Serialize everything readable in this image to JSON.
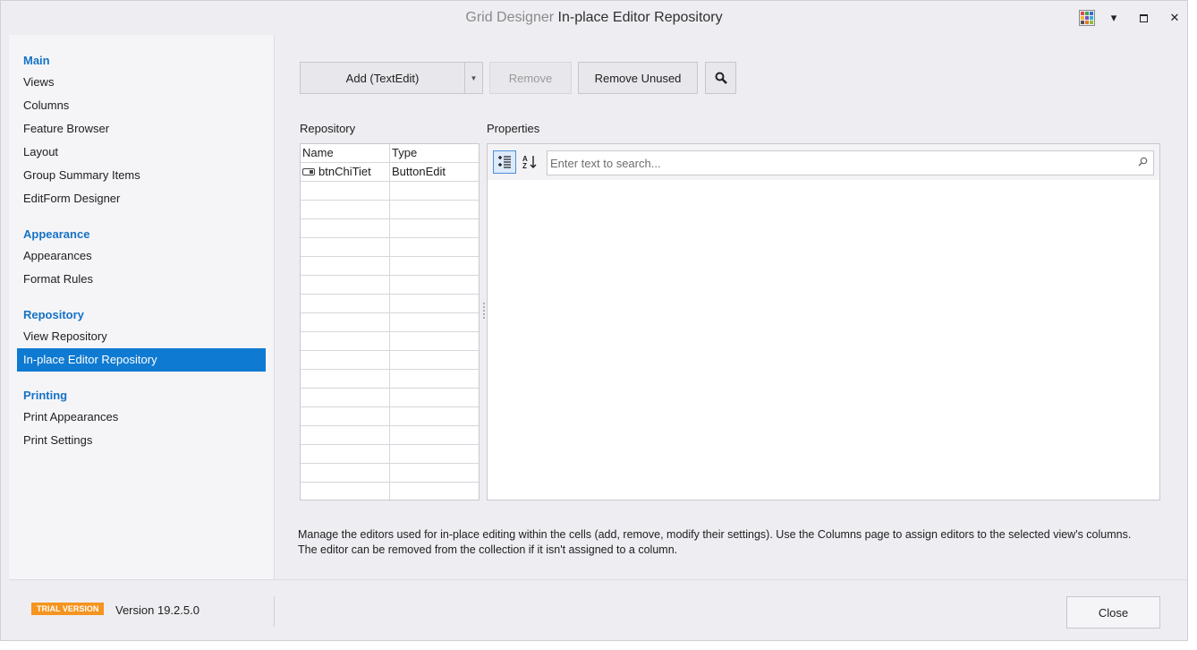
{
  "window": {
    "title_app": "Grid Designer",
    "title_page": "In-place Editor Repository",
    "skin_icon": "color-grid-icon",
    "dropdown_icon": "▾",
    "maximize_icon": "maximize-icon",
    "close_icon": "✕"
  },
  "nav": {
    "groups": [
      {
        "label": "Main",
        "items": [
          "Views",
          "Columns",
          "Feature Browser",
          "Layout",
          "Group Summary Items",
          "EditForm Designer"
        ]
      },
      {
        "label": "Appearance",
        "items": [
          "Appearances",
          "Format Rules"
        ]
      },
      {
        "label": "Repository",
        "items": [
          "View Repository",
          "In-place Editor Repository"
        ]
      },
      {
        "label": "Printing",
        "items": [
          "Print Appearances",
          "Print Settings"
        ]
      }
    ],
    "selected": "In-place Editor Repository"
  },
  "toolbar": {
    "add_label": "Add (TextEdit)",
    "remove_label": "Remove",
    "remove_unused_label": "Remove Unused",
    "search_icon": "magnifier-icon"
  },
  "repository": {
    "label": "Repository",
    "columns": [
      "Name",
      "Type"
    ],
    "rows": [
      {
        "name": "btnChiTiet",
        "type": "ButtonEdit"
      }
    ]
  },
  "properties": {
    "label": "Properties",
    "search_placeholder": "Enter text to search..."
  },
  "description": "Manage the editors used for in-place editing within the cells (add, remove, modify their settings). Use the Columns page to assign editors to the selected view's columns. The editor can be removed from the collection if it isn't assigned to a column.",
  "footer": {
    "trial_badge": "TRIAL VERSION",
    "version": "Version 19.2.5.0",
    "close_label": "Close"
  },
  "colors": {
    "accent": "#0f7ad1",
    "group_header": "#1572c5",
    "trial_badge": "#f5941f"
  }
}
